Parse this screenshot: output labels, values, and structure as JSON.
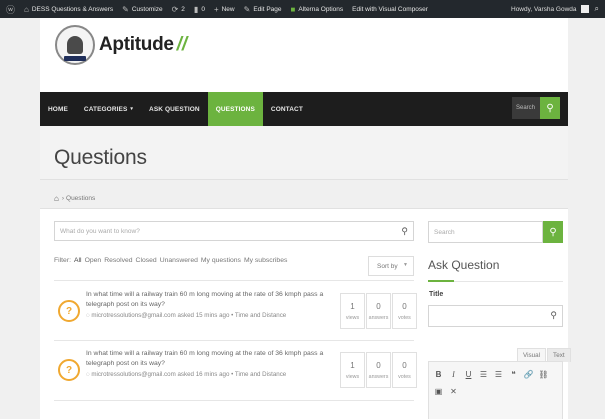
{
  "adminbar": {
    "site_name": "DESS Questions & Answers",
    "customize": "Customize",
    "comments_count": "2",
    "updates_count": "0",
    "new_label": "New",
    "edit_page": "Edit Page",
    "alterna_options": "Alterna Options",
    "visual_composer": "Edit with Visual Composer",
    "howdy": "Howdy, Varsha Gowda"
  },
  "logo": {
    "text": "Aptitude",
    "accent": "//"
  },
  "nav": {
    "items": [
      {
        "label": "HOME"
      },
      {
        "label": "CATEGORIES",
        "caret": "▾"
      },
      {
        "label": "ASK QUESTION"
      },
      {
        "label": "QUESTIONS",
        "active": true
      },
      {
        "label": "CONTACT"
      }
    ],
    "search_placeholder": "Search"
  },
  "page": {
    "title": "Questions",
    "breadcrumb": "Questions"
  },
  "main": {
    "search_placeholder": "What do you want to know?",
    "filters_label": "Filter:",
    "filters": [
      "All",
      "Open",
      "Resolved",
      "Closed",
      "Unanswered",
      "My questions",
      "My subscribes"
    ],
    "sort_label": "Sort by"
  },
  "questions": [
    {
      "title": "In what time will a railway train 60 m long moving at the rate of 36 kmph pass a telegraph post on its way?",
      "meta": "microtressolutions@gmail.com asked 15 mins ago • Time and Distance",
      "views": "1",
      "answers": "0",
      "votes": "0",
      "views_label": "views",
      "answers_label": "answers",
      "votes_label": "votes"
    },
    {
      "title": "In what time will a railway train 60 m long moving at the rate of 36 kmph pass a telegraph post on its way?",
      "meta": "microtressolutions@gmail.com asked 16 mins ago • Time and Distance",
      "views": "1",
      "answers": "0",
      "votes": "0",
      "views_label": "views",
      "answers_label": "answers",
      "votes_label": "votes"
    }
  ],
  "sidebar": {
    "search_placeholder": "Search",
    "heading": "Ask Question",
    "title_label": "Title",
    "tab_visual": "Visual",
    "tab_text": "Text",
    "toolbar": [
      "B",
      "I",
      "U",
      "☰",
      "☰",
      "❝",
      "🔗",
      "⛓",
      "▣",
      "✕"
    ]
  },
  "colors": {
    "accent": "#6cb33f",
    "nav_bg": "#1d1d1d",
    "adminbar_bg": "#23282d",
    "badge": "#f0a830"
  }
}
